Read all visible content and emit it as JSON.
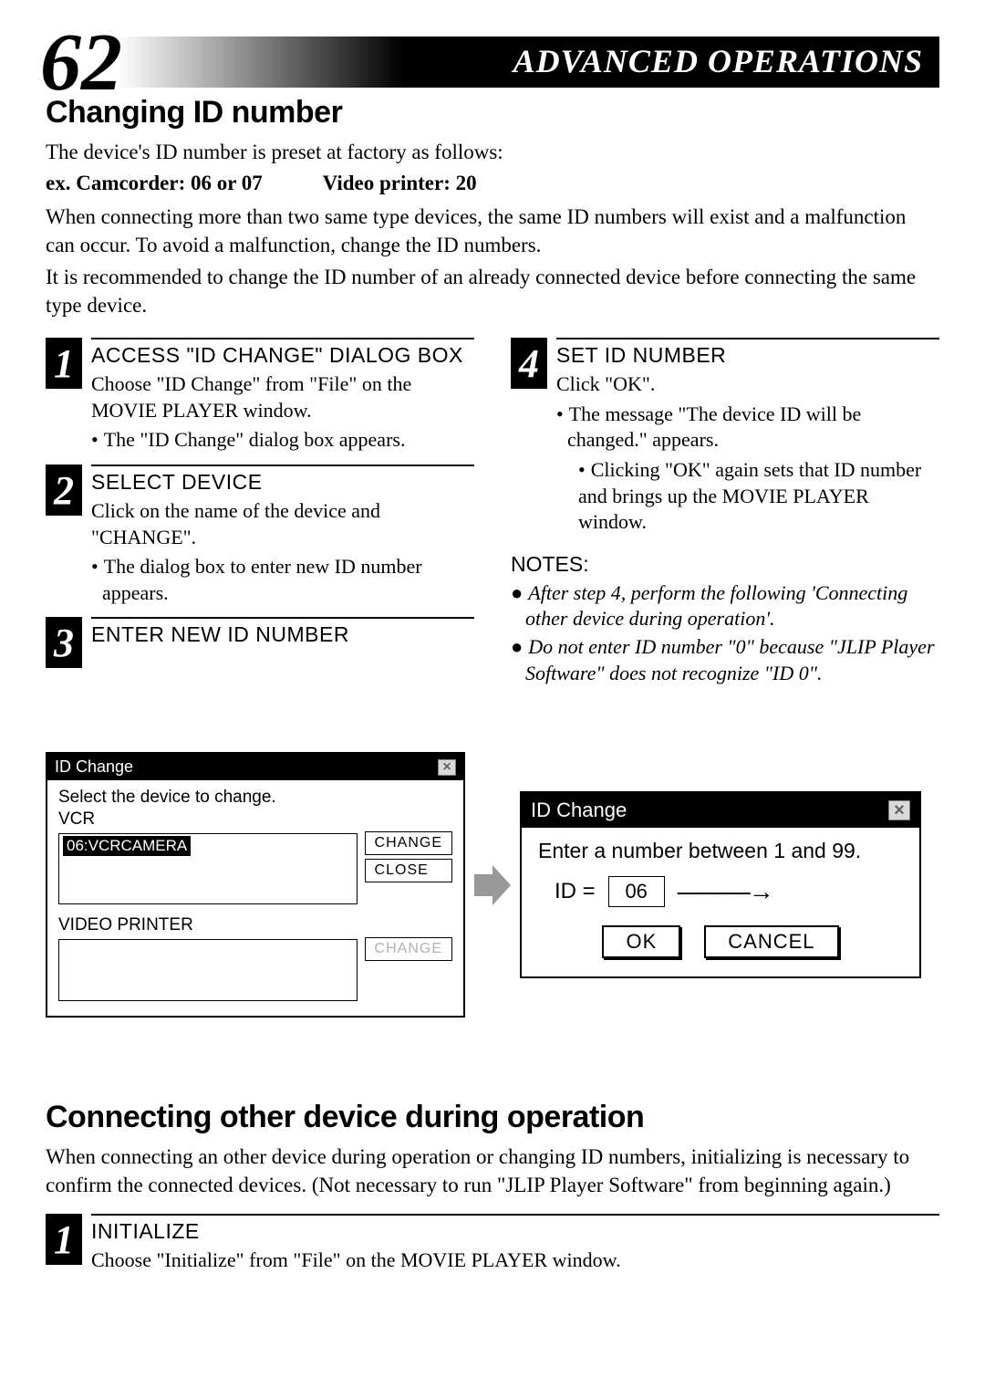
{
  "page_number": "62",
  "banner_title": "ADVANCED OPERATIONS",
  "section1": {
    "heading": "Changing ID number",
    "intro": "The device's ID number is preset at factory as follows:",
    "example_left": "ex. Camcorder: 06 or 07",
    "example_right": "Video printer: 20",
    "para1": "When connecting more than two same type devices, the same ID numbers will exist and a malfunction can occur. To avoid a malfunction, change the ID numbers.",
    "para2": "It is recommended to change the ID number of an already connected device before connecting the same type device."
  },
  "steps_left": [
    {
      "num": "1",
      "title": "ACCESS \"ID CHANGE\" DIALOG BOX",
      "desc": "Choose \"ID Change\" from \"File\" on the MOVIE PLAYER window.",
      "bullets": [
        "The \"ID Change\" dialog box appears."
      ]
    },
    {
      "num": "2",
      "title": "SELECT DEVICE",
      "desc": "Click on the name of the device and \"CHANGE\".",
      "bullets": [
        "The dialog box to enter new ID number appears."
      ]
    },
    {
      "num": "3",
      "title": "ENTER NEW ID NUMBER",
      "desc": "",
      "bullets": []
    }
  ],
  "steps_right": [
    {
      "num": "4",
      "title": "SET ID NUMBER",
      "desc": "Click \"OK\".",
      "bullets": [
        "The message \"The device ID will be changed.\" appears.",
        "Clicking \"OK\" again sets that ID number and brings up the MOVIE PLAYER window."
      ]
    }
  ],
  "notes_head": "NOTES:",
  "notes": [
    "After step 4, perform the following 'Connecting other device during operation'.",
    "Do not enter ID number \"0\" because \"JLIP Player Software\" does not recognize \"ID 0\"."
  ],
  "dialog1": {
    "title": "ID Change",
    "prompt": "Select the device to change.",
    "group1": "VCR",
    "item1": "06:VCRCAMERA",
    "change": "CHANGE",
    "close": "CLOSE",
    "group2": "VIDEO PRINTER"
  },
  "dialog2": {
    "title": "ID Change",
    "prompt": "Enter a number between 1 and 99.",
    "id_label": "ID  =",
    "id_value": "06",
    "ok": "OK",
    "cancel": "CANCEL"
  },
  "section2": {
    "heading": "Connecting other device during operation",
    "para": "When connecting an other device during operation or changing ID numbers, initializing is necessary to confirm the connected devices. (Not necessary to run \"JLIP Player Software\" from beginning again.)"
  },
  "step2_1": {
    "num": "1",
    "title": "INITIALIZE",
    "desc": "Choose \"Initialize\" from \"File\" on the MOVIE PLAYER window."
  }
}
